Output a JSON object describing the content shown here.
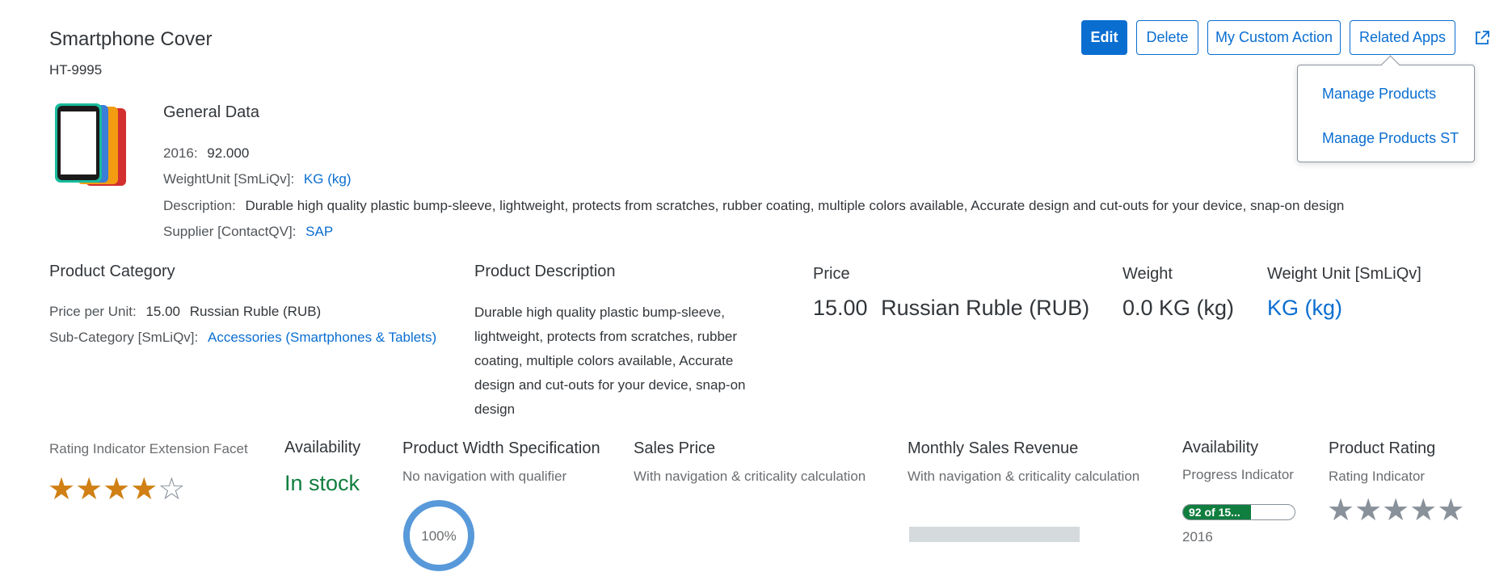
{
  "header": {
    "title": "Smartphone Cover",
    "subtitle": "HT-9995"
  },
  "actions": {
    "edit": "Edit",
    "delete": "Delete",
    "custom": "My Custom Action",
    "related": "Related Apps",
    "share_icon": "share-icon"
  },
  "related_apps_menu": {
    "items": [
      "Manage Products",
      "Manage Products ST"
    ]
  },
  "general_data": {
    "title": "General Data",
    "year_label": "2016:",
    "year_value": "92.000",
    "weight_unit_label": "WeightUnit [SmLiQv]:",
    "weight_unit_value": "KG (kg)",
    "description_label": "Description:",
    "description_value": "Durable high quality plastic bump-sleeve, lightweight, protects from scratches, rubber coating, multiple colors available, Accurate design and cut-outs for your device, snap-on design",
    "supplier_label": "Supplier [ContactQV]:",
    "supplier_value": "SAP"
  },
  "product_category": {
    "title": "Product Category",
    "price_label": "Price per Unit:",
    "price_value": "15.00",
    "price_currency": "Russian Ruble (RUB)",
    "subcat_label": "Sub-Category [SmLiQv]:",
    "subcat_value": "Accessories (Smartphones & Tablets)"
  },
  "product_description": {
    "title": "Product Description",
    "lines": [
      "Durable high quality plastic bump-sleeve,",
      "lightweight, protects from scratches, rubber",
      "coating, multiple colors available, Accurate",
      "design and cut-outs for your device, snap-on",
      "design"
    ]
  },
  "kpis": {
    "price_title": "Price",
    "price_value": "15.00",
    "price_currency": "Russian Ruble (RUB)",
    "weight_title": "Weight",
    "weight_value": "0.0 KG (kg)",
    "weight_unit_title": "Weight Unit [SmLiQv]",
    "weight_unit_value": "KG (kg)"
  },
  "facets": {
    "rating_ext": {
      "title": "Rating Indicator Extension Facet",
      "rating": 4,
      "max": 5
    },
    "availability": {
      "title": "Availability",
      "value": "In stock"
    },
    "width_spec": {
      "title": "Product Width Specification",
      "subtitle": "No navigation with qualifier",
      "value": "100%",
      "percent": 100
    },
    "sales_price": {
      "title": "Sales Price",
      "subtitle": "With navigation & criticality calculation"
    },
    "monthly_revenue": {
      "title": "Monthly Sales Revenue",
      "subtitle": "With navigation & criticality calculation"
    },
    "availability_progress": {
      "title": "Availability",
      "subtitle": "Progress Indicator",
      "display": "92 of 15...",
      "percent": 61,
      "year": "2016"
    },
    "product_rating": {
      "title": "Product Rating",
      "subtitle": "Rating Indicator",
      "rating": 0,
      "max": 5
    }
  },
  "colors": {
    "accent": "#0a6ed1",
    "positive": "#107e3e",
    "star_filled": "#d08014",
    "star_empty": "#89919a"
  }
}
